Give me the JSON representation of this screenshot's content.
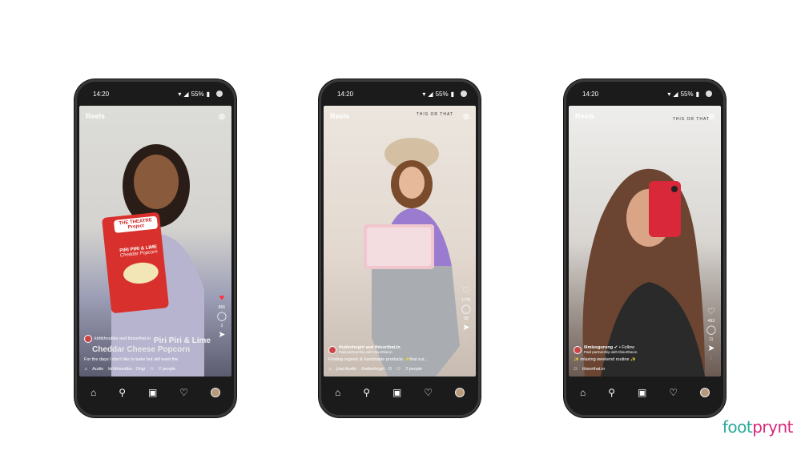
{
  "phones": [
    {
      "status": {
        "time": "14:20",
        "battery": "55%"
      },
      "header": {
        "title": "Reels"
      },
      "side": {
        "likes": "866",
        "comments": "3"
      },
      "caption": {
        "username": "kirtibhoutika and thisorthat.in",
        "overlay_text": "Piri Piri & Lime",
        "overlay_text2": "Cheddar Cheese Popcorn",
        "description": "For the days I don't like to bake but still want the",
        "audio": "Audio",
        "audio_user": "kirtibhoutika · Origi",
        "people": "2 people"
      },
      "product": {
        "brand": "THE THEATRE Project",
        "name": "PIRI PIRI & LIME",
        "sub": "Cheddar Popcorn"
      }
    },
    {
      "status": {
        "time": "14:20",
        "battery": "55%"
      },
      "header": {
        "title": "Reels"
      },
      "brand_mark": "THIS OR THAT",
      "side": {
        "likes": "1776",
        "comments": "58"
      },
      "caption": {
        "username": "thatbohogirl and thisorthat.in",
        "partnership": "Paid partnership with thisorthat.in",
        "description": "Finding organic & handmade products ✨that sui...",
        "audio": "jinal Audio",
        "audio_user": "thatbohogirl · O",
        "people": "2 people"
      }
    },
    {
      "status": {
        "time": "14:20",
        "battery": "55%"
      },
      "header": {
        "title": "Reels"
      },
      "brand_mark": "THIS OR THAT",
      "side": {
        "likes": "493",
        "comments": "11"
      },
      "caption": {
        "username": "lilmissgurung",
        "follow": "• Follow",
        "partnership": "Paid partnership with thisorthat.in",
        "description": "✨ relaxing weekend routine ✨",
        "tag": "thisorthat.in"
      }
    }
  ],
  "logo": {
    "part1": "foot",
    "part2": "prynt"
  },
  "colors": {
    "logo_teal": "#2aa99a",
    "logo_pink": "#d8287a",
    "like_red": "#ff3040"
  }
}
